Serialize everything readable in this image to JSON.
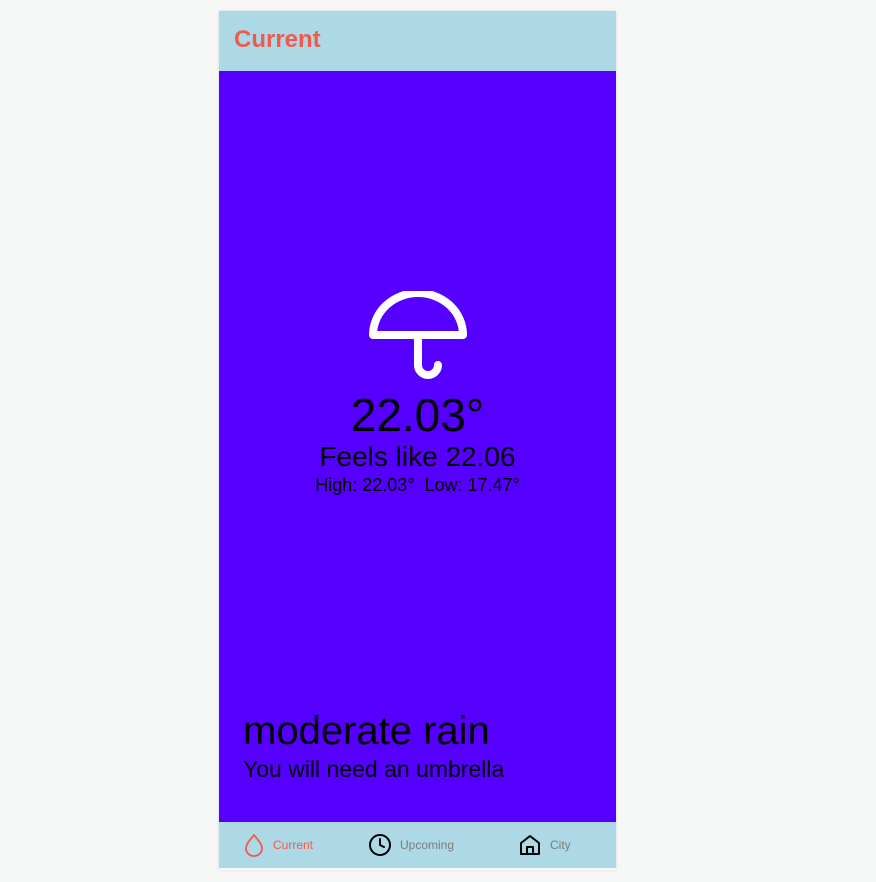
{
  "header": {
    "title": "Current"
  },
  "weather": {
    "icon": "umbrella-icon",
    "temperature": "22.03°",
    "feels_like": "Feels like 22.06",
    "high_low": "High: 22.03°  Low: 17.47°",
    "description": "moderate rain",
    "advice": "You will need an umbrella"
  },
  "tabs": [
    {
      "label": "Current",
      "icon": "droplet-icon",
      "active": true
    },
    {
      "label": "Upcoming",
      "icon": "clock-icon",
      "active": false
    },
    {
      "label": "City",
      "icon": "home-icon",
      "active": false
    }
  ],
  "colors": {
    "background": "#5500ff",
    "header": "#add8e6",
    "accent": "#f05a4f",
    "inactive_tab": "#7c7c7c"
  }
}
